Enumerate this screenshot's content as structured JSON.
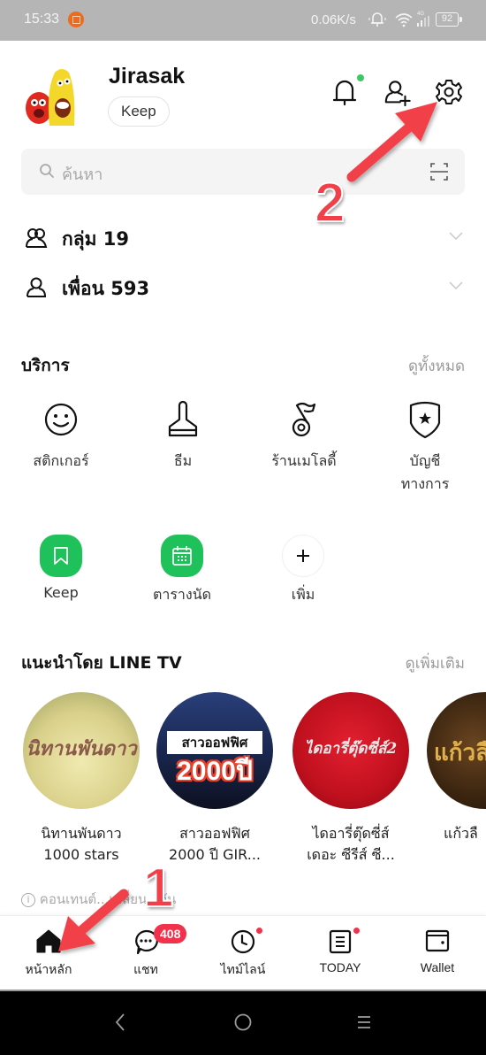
{
  "status_bar": {
    "time": "15:33",
    "network_speed": "0.06K/s",
    "network_type": "4G",
    "battery": "92",
    "icons": [
      "screen-record-icon",
      "alarm-bell-icon",
      "wifi-icon",
      "signal-icon",
      "battery-icon"
    ]
  },
  "profile": {
    "name": "Jirasak",
    "keep_label": "Keep",
    "avatar_icon": "larva-avatar-icon"
  },
  "header_actions": {
    "notifications_icon": "bell-icon",
    "add_friend_icon": "add-friend-icon",
    "settings_icon": "gear-icon",
    "notification_dot_color": "#3ec764"
  },
  "search": {
    "placeholder": "ค้นหา",
    "scan_icon": "qr-scan-icon"
  },
  "lists": [
    {
      "label": "กลุ่ม 19",
      "icon": "group-icon"
    },
    {
      "label": "เพื่อน 593",
      "icon": "friend-icon"
    }
  ],
  "services": {
    "title": "บริการ",
    "see_all": "ดูทั้งหมด",
    "items": [
      {
        "label": "สติกเกอร์",
        "icon": "smiley-icon"
      },
      {
        "label": "ธีม",
        "icon": "paint-brush-icon"
      },
      {
        "label": "ร้านเมโลดี้",
        "icon": "music-note-icon"
      },
      {
        "label": "บัญชี\nทางการ",
        "label_line1": "บัญชี",
        "label_line2": "ทางการ",
        "icon": "shield-star-icon"
      }
    ],
    "apps": [
      {
        "label": "Keep",
        "icon": "bookmark-icon"
      },
      {
        "label": "ตารางนัด",
        "icon": "calendar-icon"
      },
      {
        "label": "เพิ่ม",
        "icon": "plus-icon"
      }
    ],
    "accent_color": "#1fc25a"
  },
  "line_tv": {
    "title": "แนะนำโดย LINE TV",
    "see_more": "ดูเพิ่มเติม",
    "items": [
      {
        "title_line1": "นิทานพันดาว",
        "title_line2": "1000 stars",
        "thumb_text": "นิทานพันดาว"
      },
      {
        "title_line1": "สาวออฟฟิศ",
        "title_line2": "2000 ปี GIR...",
        "thumb_text_top": "สาวออฟฟิศ",
        "thumb_text_bottom": "2000ปี"
      },
      {
        "title_line1": "ไดอารี่ตุ๊ดซี่ส์",
        "title_line2": "เดอะ ซีรีส์ ซี...",
        "thumb_text": "ไดอารี่ตุ๊ดซี่ส์2"
      },
      {
        "title_line1": "แก้วลื",
        "title_line2": "",
        "thumb_text": "แก้วลื"
      }
    ],
    "info_note": "คอนเทนต์...เปลี่ยน...วัน"
  },
  "bottom_nav": {
    "items": [
      {
        "label": "หน้าหลัก",
        "icon": "home-icon",
        "active": true
      },
      {
        "label": "แชท",
        "icon": "chat-icon",
        "badge": "408"
      },
      {
        "label": "ไทม์ไลน์",
        "icon": "clock-icon",
        "dot": true
      },
      {
        "label": "TODAY",
        "icon": "news-icon",
        "dot": true
      },
      {
        "label": "Wallet",
        "icon": "wallet-icon"
      }
    ],
    "badge_color": "#f2324d"
  },
  "system_nav": {
    "icons": [
      "back-icon",
      "home-circle-icon",
      "menu-icon"
    ]
  },
  "annotations": {
    "step1": "1",
    "step2": "2",
    "color": "#f2404a"
  }
}
